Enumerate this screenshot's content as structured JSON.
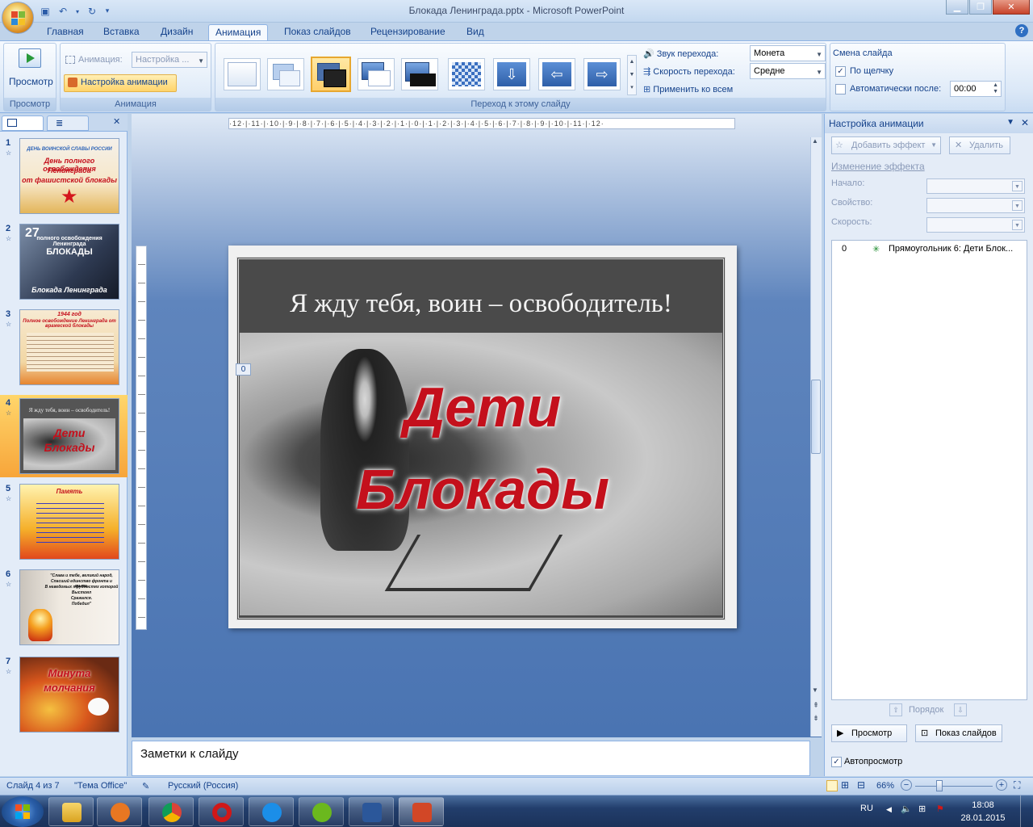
{
  "window": {
    "title": "Блокада Ленинграда.pptx - Microsoft PowerPoint"
  },
  "tabs": [
    "Главная",
    "Вставка",
    "Дизайн",
    "Анимация",
    "Показ слайдов",
    "Рецензирование",
    "Вид"
  ],
  "active_tab": "Анимация",
  "ribbon": {
    "preview": {
      "button": "Просмотр",
      "group": "Просмотр"
    },
    "animations": {
      "animation_label": "Анимация:",
      "animation_value": "Настройка ...",
      "custom_button": "Настройка анимации",
      "group": "Анимация"
    },
    "transition": {
      "group": "Переход к этому слайду",
      "sound_label": "Звук перехода:",
      "sound_value": "Монета",
      "speed_label": "Скорость перехода:",
      "speed_value": "Средне",
      "apply_all": "Применить ко всем"
    },
    "advance": {
      "header": "Смена слайда",
      "on_click": "По щелчку",
      "auto_after": "Автоматически после:",
      "time_value": "00:00"
    }
  },
  "ruler": {
    "horizontal": "·12·|·11·|·10·|·9·|·8·|·7·|·6·|·5·|·4·|·3·|·2·|·1·|·0·|·1·|·2·|·3·|·4·|·5·|·6·|·7·|·8·|·9·|·10·|·11·|·12·"
  },
  "slides": [
    {
      "num": "1",
      "lines": [
        "ДЕНЬ ВОИНСКОЙ СЛАВЫ РОССИИ",
        "День полного освобождения",
        "Ленинграда",
        "от фашистской блокады"
      ]
    },
    {
      "num": "2",
      "lines": [
        "27",
        "полного освобождения Ленинграда",
        "БЛОКАДЫ",
        "Блокада Ленинграда"
      ]
    },
    {
      "num": "3",
      "lines": [
        "1944 год",
        "Полное освобождение Ленинграда от вражеской блокады"
      ]
    },
    {
      "num": "4",
      "lines": [
        "Я жду тебя, воин – освободитель!",
        "Дети",
        "Блокады"
      ]
    },
    {
      "num": "5",
      "lines": [
        "Память"
      ]
    },
    {
      "num": "6",
      "lines": [
        "\"Слава и тебе, великий народ,",
        "Спасший единство фронта и тыла.",
        "В неведомых трудностях которой",
        "Выстоял",
        "Сражался.",
        "Победил\""
      ]
    },
    {
      "num": "7",
      "lines": [
        "Минута",
        "молчания"
      ]
    }
  ],
  "current_slide": {
    "subtitle": "Я жду тебя, воин – освободитель!",
    "title_line1": "Дети",
    "title_line2": "Блокады",
    "anim_tag": "0"
  },
  "notes_placeholder": "Заметки к слайду",
  "task_pane": {
    "title": "Настройка анимации",
    "add_effect": "Добавить эффект",
    "remove": "Удалить",
    "modify_header": "Изменение эффекта",
    "start_label": "Начало:",
    "property_label": "Свойство:",
    "speed_label": "Скорость:",
    "items": [
      {
        "order": "0",
        "name": "Прямоугольник 6: Дети Блок..."
      }
    ],
    "reorder": "Порядок",
    "play_button": "Просмотр",
    "slideshow_button": "Показ слайдов",
    "autopreview": "Автопросмотр"
  },
  "status": {
    "slide_info": "Слайд 4 из 7",
    "theme": "\"Тема Office\"",
    "language": "Русский (Россия)",
    "zoom": "66%"
  },
  "taskbar": {
    "lang": "RU",
    "time": "18:08",
    "date": "28.01.2015"
  }
}
